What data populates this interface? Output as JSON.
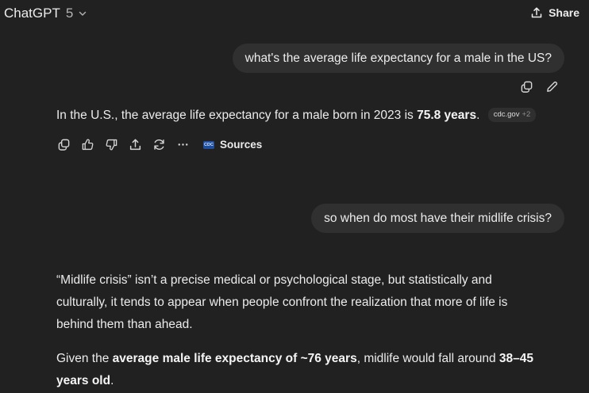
{
  "header": {
    "model_name": "ChatGPT",
    "model_version": "5",
    "share_label": "Share"
  },
  "conversation": {
    "user_msg_1": "what's the average life expectancy for a male in the US?",
    "assistant_1": {
      "text_a": "In the U.S., the average life expectancy for a male born in 2023 is ",
      "text_bold": "75.8 years",
      "text_end": ".",
      "citation": "cdc.gov",
      "citation_more": "+2",
      "sources_label": "Sources",
      "source_favicon_text": "CDC"
    },
    "user_msg_2": "so when do most have their midlife crisis?",
    "assistant_2": {
      "p1_a": "“Midlife crisis” isn’t a precise medical or psychological stage, but statistically and",
      "p1_b": "culturally, it tends to appear when people confront the realization that more of life is",
      "p1_c": "behind them than ahead.",
      "p2_a": "Given the ",
      "p2_bold1": "average male life expectancy of ~76 years",
      "p2_b": ", midlife would fall around ",
      "p2_bold2": "38–45",
      "p2_bold3": "years old",
      "p2_end": "."
    }
  }
}
